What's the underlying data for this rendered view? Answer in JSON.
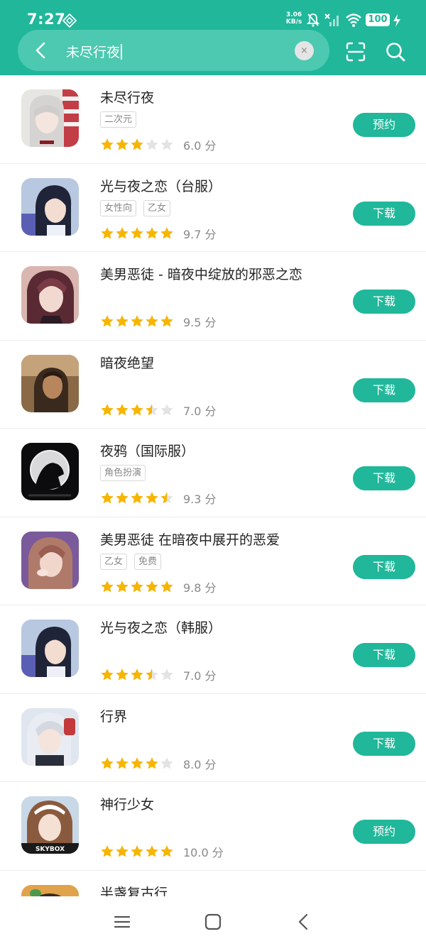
{
  "status": {
    "time": "7:27",
    "net_speed_value": "3.06",
    "net_speed_unit": "KB/s",
    "battery": "100"
  },
  "search": {
    "query": "未尽行夜",
    "clear_label": "×"
  },
  "results": [
    {
      "name": "未尽行夜",
      "tags": [
        "二次元"
      ],
      "stars": 3,
      "score_label": "6.0 分",
      "button": "预约"
    },
    {
      "name": "光与夜之恋（台服）",
      "tags": [
        "女性向",
        "乙女"
      ],
      "stars": 5,
      "score_label": "9.7 分",
      "button": "下载"
    },
    {
      "name": "美男恶徒 - 暗夜中绽放的邪恶之恋",
      "tags": [],
      "stars": 5,
      "score_label": "9.5 分",
      "button": "下载"
    },
    {
      "name": "暗夜绝望",
      "tags": [],
      "stars": 3.5,
      "score_label": "7.0 分",
      "button": "下载"
    },
    {
      "name": "夜鸦（国际服）",
      "tags": [
        "角色扮演"
      ],
      "stars": 4.5,
      "score_label": "9.3 分",
      "button": "下载"
    },
    {
      "name": "美男恶徒 在暗夜中展开的恶爱",
      "tags": [
        "乙女",
        "免费"
      ],
      "stars": 5,
      "score_label": "9.8 分",
      "button": "下载"
    },
    {
      "name": "光与夜之恋（韩服）",
      "tags": [],
      "stars": 3.5,
      "score_label": "7.0 分",
      "button": "下载"
    },
    {
      "name": "行界",
      "tags": [],
      "stars": 4,
      "score_label": "8.0 分",
      "button": "下载"
    },
    {
      "name": "神行少女",
      "tags": [],
      "stars": 5,
      "score_label": "10.0 分",
      "button": "预约"
    },
    {
      "name": "半盏复古行",
      "tags": [],
      "stars": 0,
      "score_label": "",
      "button": ""
    }
  ],
  "icons": {
    "back": "back-arrow-icon",
    "scan": "scan-icon",
    "search": "search-icon",
    "nav_menu": "menu-icon",
    "nav_home": "home-icon",
    "nav_back": "back-icon"
  },
  "colors": {
    "accent": "#20b79a",
    "star": "#f7b500",
    "star_empty": "#e3e3e3"
  },
  "skybox_label": "SKYBOX"
}
